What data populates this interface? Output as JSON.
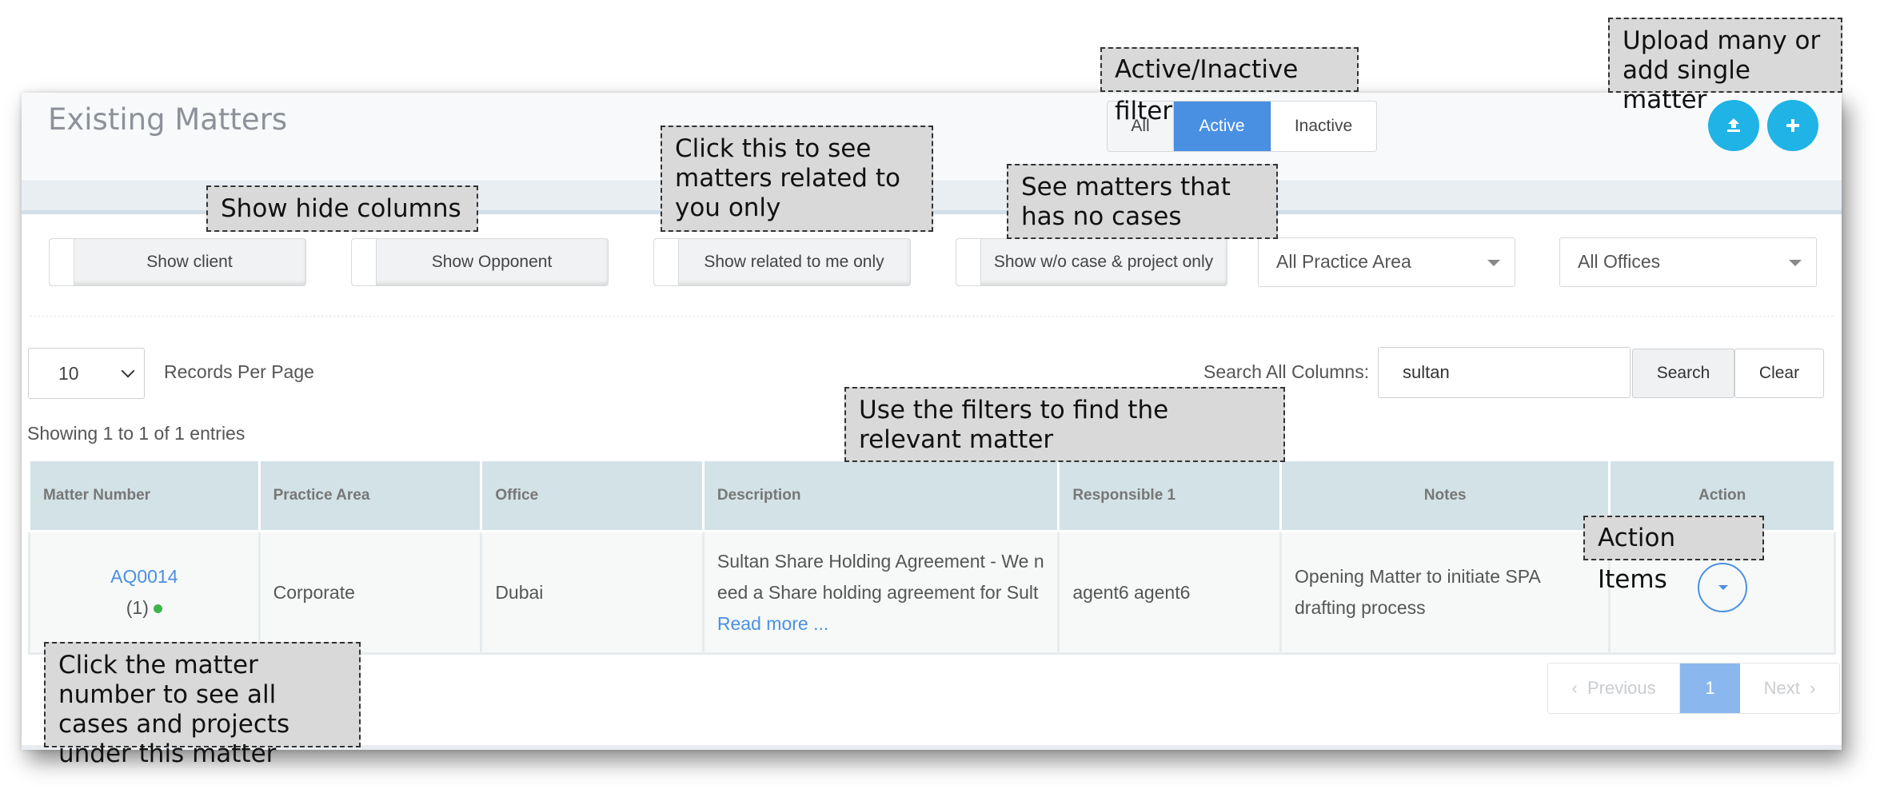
{
  "header": {
    "title": "Existing Matters",
    "status_filter": {
      "all": "All",
      "active": "Active",
      "inactive": "Inactive",
      "selected": "Active"
    }
  },
  "toggles": {
    "show_client": "Show client",
    "show_opponent": "Show Opponent",
    "show_related": "Show related to me only",
    "show_without_case": "Show w/o case & project only"
  },
  "filters": {
    "practice_area": "All Practice Area",
    "offices": "All Offices"
  },
  "records": {
    "per_page_value": "10",
    "per_page_label": "Records Per Page",
    "showing": "Showing 1 to 1 of 1 entries"
  },
  "search": {
    "label": "Search All Columns:",
    "value": "sultan",
    "search_button": "Search",
    "clear_button": "Clear"
  },
  "table": {
    "headers": [
      "Matter Number",
      "Practice Area",
      "Office",
      "Description",
      "Responsible 1",
      "Notes",
      "Action"
    ],
    "rows": [
      {
        "matter_number": "AQ0014",
        "count": "(1)",
        "practice_area": "Corporate",
        "office": "Dubai",
        "description": "Sultan Share Holding Agreement - We need a Share holding agreement for Sult",
        "read_more": "Read more ...",
        "responsible": "agent6 agent6",
        "notes": "Opening Matter to initiate SPA drafting process"
      }
    ]
  },
  "pagination": {
    "previous": "Previous",
    "current": "1",
    "next": "Next"
  },
  "annotations": {
    "active_filter": "Active/Inactive filter",
    "upload": "Upload many or add single matter",
    "show_hide": "Show hide columns",
    "related": "Click this to see matters related to you only",
    "no_cases": "See matters that has no cases",
    "use_filters": "Use the filters to find the relevant matter",
    "action_items": "Action Items",
    "matter_number": "Click the matter number to see all cases and projects under this matter"
  },
  "colors": {
    "accent": "#4a90e2",
    "round_button": "#1fb3e6",
    "status_dot": "#3cb54a",
    "table_header": "#d3e2e6"
  },
  "icons": {
    "upload": "upload-icon",
    "add": "plus-icon"
  }
}
